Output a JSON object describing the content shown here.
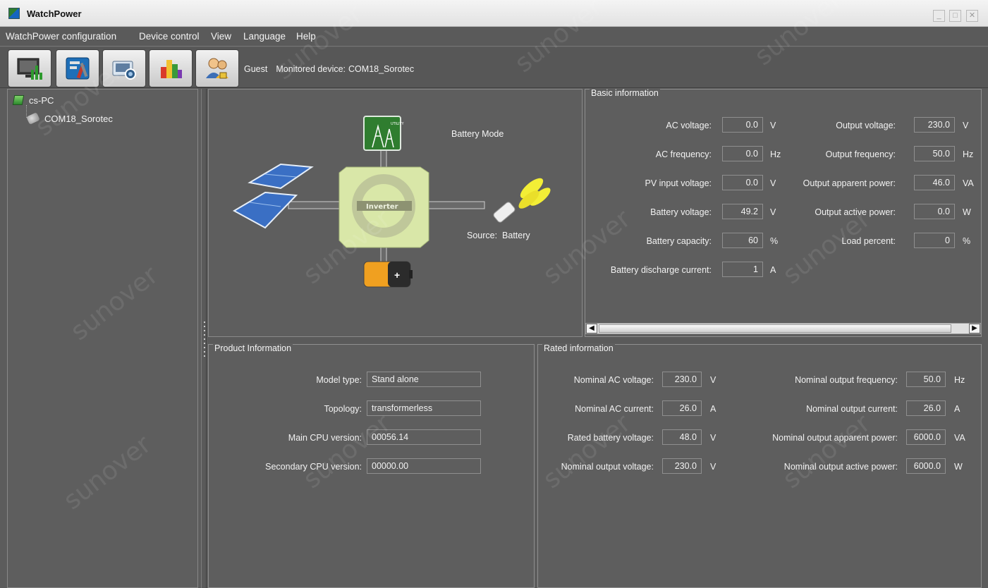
{
  "window": {
    "title": "WatchPower",
    "minimize": "_",
    "maximize": "□",
    "close": "✕"
  },
  "menu": [
    "WatchPower configuration",
    "Device control",
    "View",
    "Language",
    "Help"
  ],
  "toolbar": {
    "buttons": [
      "monitor-icon",
      "config-tools-icon",
      "camera-icon",
      "data-chart-icon",
      "users-icon"
    ],
    "user": "Guest",
    "monitored_label": "Monitored device:",
    "monitored_device": "COM18_Sorotec"
  },
  "tree": {
    "computer": "cs-PC",
    "device": "COM18_Sorotec"
  },
  "diagram": {
    "mode": "Battery Mode",
    "source_label": "Source:",
    "source_value": "Battery",
    "inverter_label": "Inverter",
    "utility_label": "UTILITY"
  },
  "basic": {
    "title": "Basic information",
    "left": [
      {
        "label": "AC voltage:",
        "value": "0.0",
        "unit": "V"
      },
      {
        "label": "AC frequency:",
        "value": "0.0",
        "unit": "Hz"
      },
      {
        "label": "PV input voltage:",
        "value": "0.0",
        "unit": "V"
      },
      {
        "label": "Battery voltage:",
        "value": "49.2",
        "unit": "V"
      },
      {
        "label": "Battery capacity:",
        "value": "60",
        "unit": "%"
      },
      {
        "label": "Battery discharge current:",
        "value": "1",
        "unit": "A"
      }
    ],
    "right": [
      {
        "label": "Output voltage:",
        "value": "230.0",
        "unit": "V"
      },
      {
        "label": "Output frequency:",
        "value": "50.0",
        "unit": "Hz"
      },
      {
        "label": "Output apparent power:",
        "value": "46.0",
        "unit": "VA"
      },
      {
        "label": "Output active power:",
        "value": "0.0",
        "unit": "W"
      },
      {
        "label": "Load percent:",
        "value": "0",
        "unit": "%"
      }
    ]
  },
  "product": {
    "title": "Product Information",
    "rows": [
      {
        "label": "Model type:",
        "value": "Stand alone"
      },
      {
        "label": "Topology:",
        "value": "transformerless"
      },
      {
        "label": "Main CPU version:",
        "value": "00056.14"
      },
      {
        "label": "Secondary CPU version:",
        "value": "00000.00"
      }
    ]
  },
  "rated": {
    "title": "Rated information",
    "left": [
      {
        "label": "Nominal AC voltage:",
        "value": "230.0",
        "unit": "V"
      },
      {
        "label": "Nominal AC current:",
        "value": "26.0",
        "unit": "A"
      },
      {
        "label": "Rated battery voltage:",
        "value": "48.0",
        "unit": "V"
      },
      {
        "label": "Nominal output voltage:",
        "value": "230.0",
        "unit": "V"
      }
    ],
    "right": [
      {
        "label": "Nominal output frequency:",
        "value": "50.0",
        "unit": "Hz"
      },
      {
        "label": "Nominal output current:",
        "value": "26.0",
        "unit": "A"
      },
      {
        "label": "Nominal output apparent power:",
        "value": "6000.0",
        "unit": "VA"
      },
      {
        "label": "Nominal output active power:",
        "value": "6000.0",
        "unit": "W"
      }
    ]
  },
  "watermark": "sunover"
}
